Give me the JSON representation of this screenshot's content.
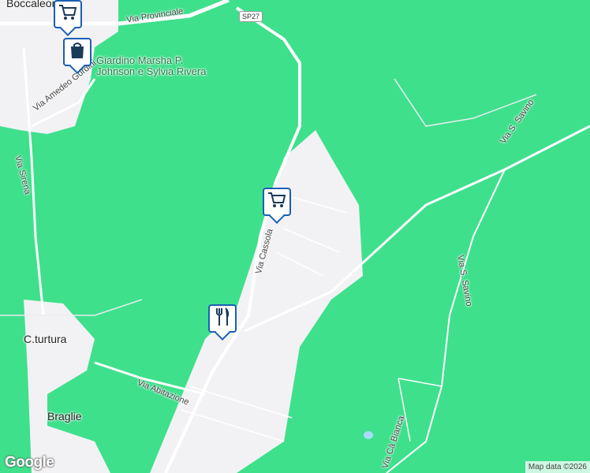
{
  "map": {
    "background_color": "#3fe08c",
    "urban_color": "#f2f2f4",
    "road_color": "#ffffff",
    "water_color": "#aadaff"
  },
  "labels": {
    "town_top": "Boccaleone",
    "via_provinciale": "Via Provinciale",
    "sp27": "SP27",
    "giardino_line1": "Giardino Marsha P.",
    "giardino_line2": "Johnson e Sylvia Rivera",
    "via_amedeo_gordini": "Via Amedeo Gordini",
    "via_sirena": "Via Sirena",
    "via_s_savino_1": "Via S. Savino",
    "via_s_savino_2": "Via S. Savino",
    "via_cassola": "Via Cassola",
    "c_turtura": "C.turtura",
    "via_abitazione": "Via Abitazione",
    "braglie": "Braglie",
    "via_ca_bianca": "Via Cà Bianca"
  },
  "markers": [
    {
      "type": "shopping-cart-icon"
    },
    {
      "type": "shopping-bag-icon"
    },
    {
      "type": "shopping-cart-icon"
    },
    {
      "type": "restaurant-icon"
    }
  ],
  "branding": {
    "logo": "Google",
    "attribution": "Map data ©2026"
  }
}
